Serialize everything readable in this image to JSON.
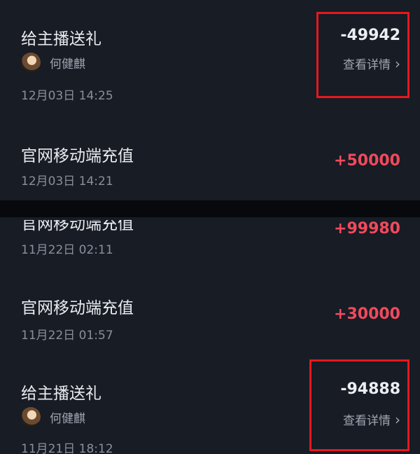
{
  "transactions": [
    {
      "title": "给主播送礼",
      "user": "何健麒",
      "date": "12月03日 14:25",
      "amount": "-49942",
      "detail_label": "查看详情"
    },
    {
      "title": "官网移动端充值",
      "date": "12月03日 14:21",
      "amount": "+50000"
    },
    {
      "title": "官网移动端充值",
      "date": "11月22日 02:11",
      "amount": "+99980"
    },
    {
      "title": "官网移动端充值",
      "date": "11月22日 01:57",
      "amount": "+30000"
    },
    {
      "title": "给主播送礼",
      "user": "何健麒",
      "date": "11月21日 18:12",
      "amount": "-94888",
      "detail_label": "查看详情"
    }
  ],
  "colors": {
    "background": "#171c25",
    "positive": "#f04a5c",
    "highlight": "#e6181e"
  },
  "icons": {
    "detail_chevron": "chevron-right-icon",
    "avatar": "avatar"
  }
}
